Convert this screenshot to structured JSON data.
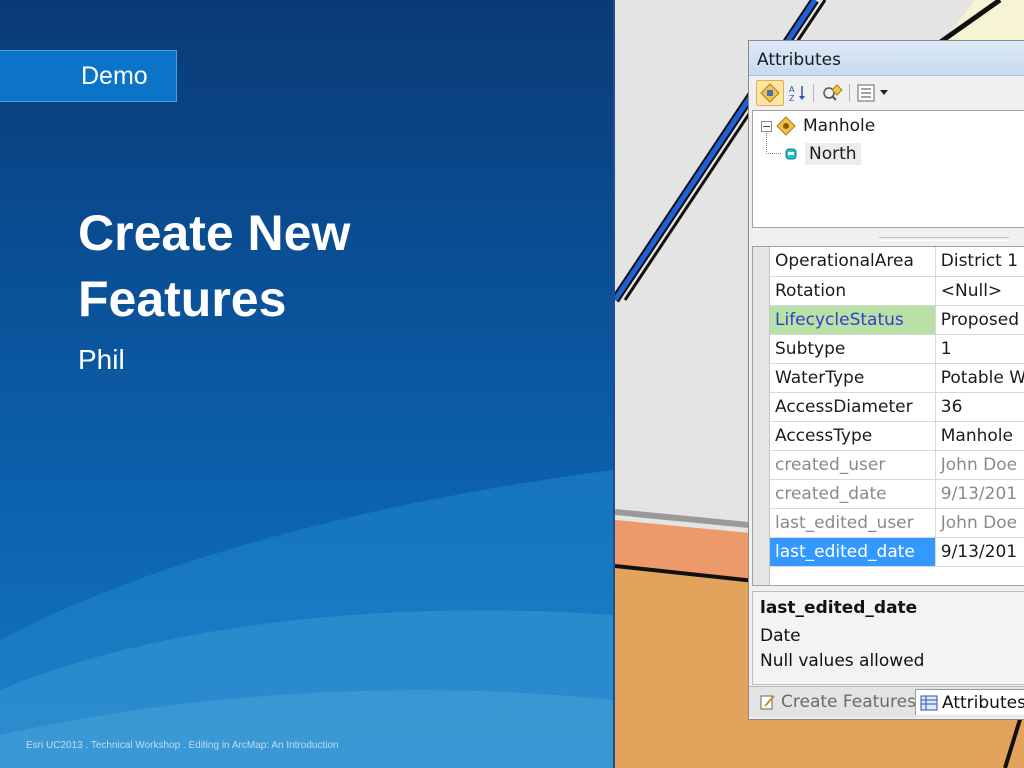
{
  "slide": {
    "section_tab": "Demo",
    "title": "Create New Features",
    "presenter": "Phil",
    "footer": "Esri UC2013 . Technical Workshop . Editing in ArcMap: An Introduction"
  },
  "attributes_window": {
    "title": "Attributes",
    "toolbar": {
      "icons": [
        "show-features-icon",
        "sort-az-icon",
        "identify-related-icon",
        "options-icon",
        "dropdown-arrow-icon"
      ]
    },
    "tree": {
      "layer": "Manhole",
      "feature": "North"
    },
    "rows": [
      {
        "field": "OperationalArea",
        "value": "District 1",
        "state": "normal"
      },
      {
        "field": "Rotation",
        "value": "<Null>",
        "state": "normal"
      },
      {
        "field": "LifecycleStatus",
        "value": "Proposed",
        "state": "highlight"
      },
      {
        "field": "Subtype",
        "value": "1",
        "state": "normal"
      },
      {
        "field": "WaterType",
        "value": "Potable W",
        "state": "normal"
      },
      {
        "field": "AccessDiameter",
        "value": "36",
        "state": "normal"
      },
      {
        "field": "AccessType",
        "value": "Manhole",
        "state": "normal"
      },
      {
        "field": "created_user",
        "value": "John Doe",
        "state": "readonly"
      },
      {
        "field": "created_date",
        "value": "9/13/201",
        "state": "readonly"
      },
      {
        "field": "last_edited_user",
        "value": "John Doe",
        "state": "readonly"
      },
      {
        "field": "last_edited_date",
        "value": "9/13/201",
        "state": "selected"
      }
    ],
    "description": {
      "field_name": "last_edited_date",
      "field_type": "Date",
      "nullability": "Null values allowed"
    },
    "tabs": {
      "create_features": "Create Features",
      "attributes": "Attributes"
    }
  },
  "colors": {
    "slide_blue": "#0a4f96",
    "highlight_green": "#b9e1a6",
    "selection_blue": "#3399ff",
    "highlight_text": "#2a44c8"
  }
}
